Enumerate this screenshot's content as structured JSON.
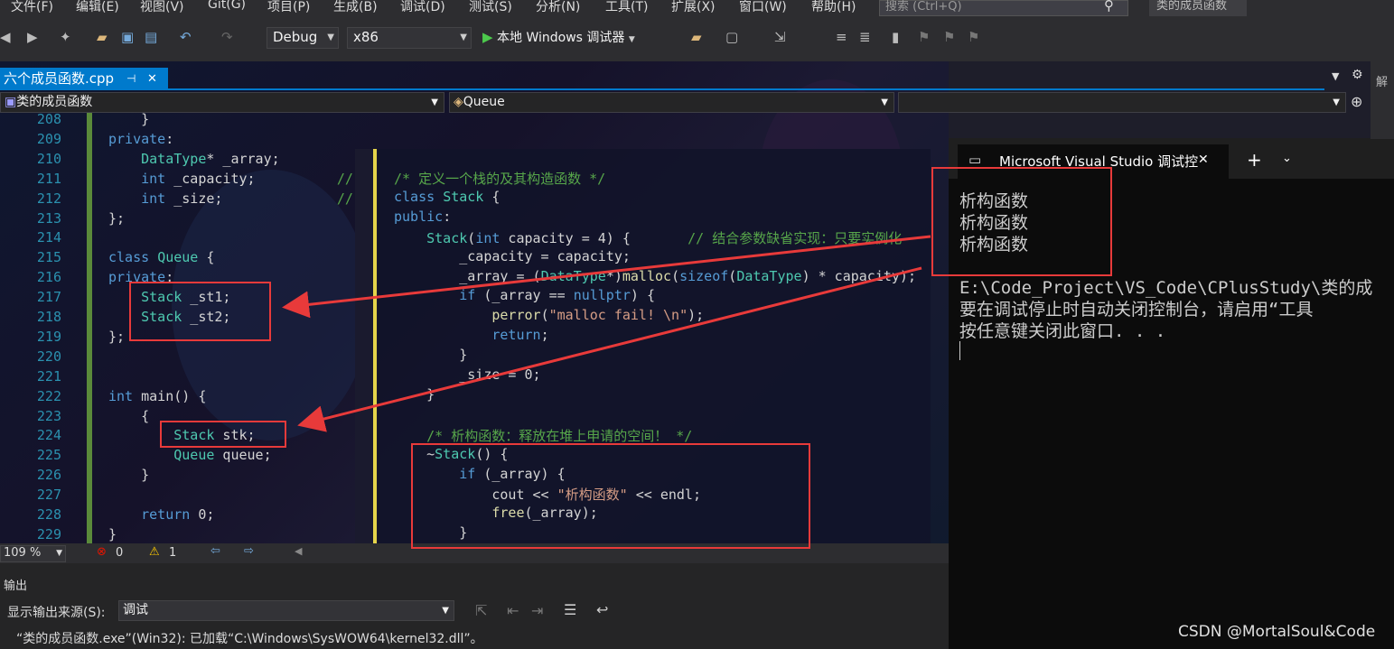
{
  "menu": [
    "文件(F)",
    "编辑(E)",
    "视图(V)",
    "Git(G)",
    "项目(P)",
    "生成(B)",
    "调试(D)",
    "测试(S)",
    "分析(N)",
    "工具(T)",
    "扩展(X)",
    "窗口(W)",
    "帮助(H)"
  ],
  "search": {
    "placeholder": "搜索 (Ctrl+Q)"
  },
  "window_title": "类的成员函数",
  "toolbar": {
    "config": "Debug",
    "platform": "x86",
    "run_label": "本地 Windows 调试器"
  },
  "tab": {
    "label": "六个成员函数.cpp",
    "pin": "⊣",
    "close": "✕"
  },
  "nav": {
    "scope": "类的成员函数",
    "member": "Queue"
  },
  "right_strip": {
    "label": "解"
  },
  "code_main": [
    {
      "n": "208",
      "t": "    }"
    },
    {
      "n": "209",
      "t": "private:"
    },
    {
      "n": "210",
      "t": "    DataType* _array;"
    },
    {
      "n": "211",
      "t": "    int _capacity;          //"
    },
    {
      "n": "212",
      "t": "    int _size;              //"
    },
    {
      "n": "213",
      "t": "};"
    },
    {
      "n": "214",
      "t": ""
    },
    {
      "n": "215",
      "t": "class Queue {"
    },
    {
      "n": "216",
      "t": "private:"
    },
    {
      "n": "217",
      "t": "    Stack _st1;"
    },
    {
      "n": "218",
      "t": "    Stack _st2;"
    },
    {
      "n": "219",
      "t": "};"
    },
    {
      "n": "220",
      "t": ""
    },
    {
      "n": "221",
      "t": ""
    },
    {
      "n": "222",
      "t": "int main() {"
    },
    {
      "n": "223",
      "t": "    {"
    },
    {
      "n": "224",
      "t": "        Stack stk;"
    },
    {
      "n": "225",
      "t": "        Queue queue;"
    },
    {
      "n": "226",
      "t": "    }"
    },
    {
      "n": "227",
      "t": ""
    },
    {
      "n": "228",
      "t": "    return 0;"
    },
    {
      "n": "229",
      "t": "}"
    }
  ],
  "code_overlay": [
    "/* 定义一个栈的及其构造函数 */",
    "class Stack {",
    "public:",
    "    Stack(int capacity = 4) {       // 结合参数缺省实现：只要实例化",
    "        _capacity = capacity;",
    "        _array = (DataType*)malloc(sizeof(DataType) * capacity);",
    "        if (_array == nullptr) {",
    "            perror(\"malloc fail! \\n\");",
    "            return;",
    "        }",
    "        _size = 0;",
    "    }",
    "",
    "    /* 析构函数：释放在堆上申请的空间！ */",
    "    ~Stack() {",
    "        if (_array) {",
    "            cout << \"析构函数\" << endl;",
    "            free(_array);",
    "        }"
  ],
  "editor_status": {
    "zoom": "109 %",
    "errors": "0",
    "warnings": "1"
  },
  "output": {
    "title": "输出",
    "source_label": "显示输出来源(S):",
    "source_value": "调试",
    "line": "“类的成员函数.exe”(Win32): 已加载“C:\\Windows\\SysWOW64\\kernel32.dll”。"
  },
  "console": {
    "title": "Microsoft Visual Studio 调试控",
    "lines": [
      "析构函数",
      "析构函数",
      "析构函数",
      "",
      "E:\\Code_Project\\VS_Code\\CPlusStudy\\类的成",
      "要在调试停止时自动关闭控制台，请启用“工具",
      "按任意键关闭此窗口. . ."
    ]
  },
  "watermark": "CSDN @MortalSoul&Code",
  "colors": {
    "accent": "#007acc",
    "annotation": "#e83a3a",
    "keyword": "#569cd6",
    "type": "#4ec9b0",
    "comment": "#57a64a"
  }
}
